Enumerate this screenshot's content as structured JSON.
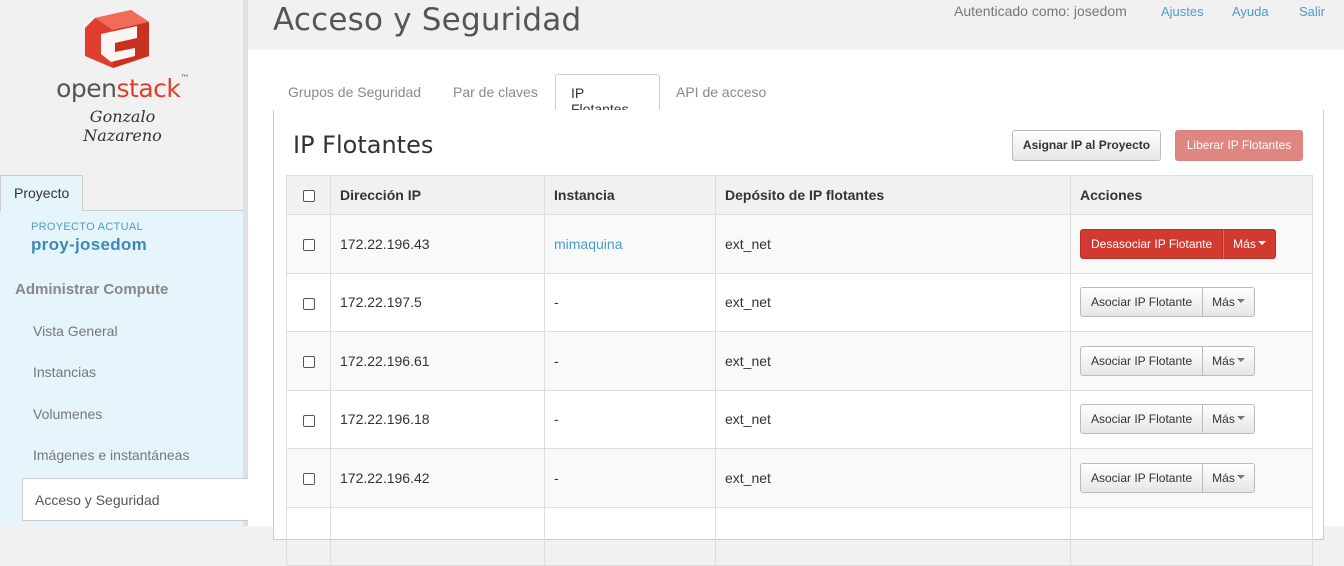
{
  "sidebar": {
    "logo": {
      "brand_open": "open",
      "brand_stack": "stack",
      "brand_tm": "™",
      "subtitle": "Gonzalo Nazareno"
    },
    "tab_label": "Proyecto",
    "current_project_label": "PROYECTO ACTUAL",
    "current_project_name": "proy-josedom",
    "section_heading": "Administrar Compute",
    "items": [
      {
        "label": "Vista General"
      },
      {
        "label": "Instancias"
      },
      {
        "label": "Volumenes"
      },
      {
        "label": "Imágenes e instantáneas"
      },
      {
        "label": "Acceso y Seguridad"
      }
    ]
  },
  "header": {
    "title": "Acceso y Seguridad",
    "authenticated_as": "Autenticado como: josedom",
    "links": [
      {
        "label": "Ajustes"
      },
      {
        "label": "Ayuda"
      },
      {
        "label": "Salir"
      }
    ]
  },
  "tabs": [
    {
      "label": "Grupos de Seguridad"
    },
    {
      "label": "Par de claves"
    },
    {
      "label": "IP Flotantes"
    },
    {
      "label": "API de acceso"
    }
  ],
  "panel": {
    "title": "IP Flotantes",
    "assign_button": "Asignar IP al Proyecto",
    "release_button": "Liberar IP Flotantes"
  },
  "table": {
    "columns": [
      "Dirección IP",
      "Instancia",
      "Depósito de IP flotantes",
      "Acciones"
    ],
    "rows": [
      {
        "ip": "172.22.196.43",
        "instance": "mimaquina",
        "pool": "ext_net",
        "action": "Desasociar IP Flotante",
        "more": "Más"
      },
      {
        "ip": "172.22.197.5",
        "instance": "-",
        "pool": "ext_net",
        "action": "Asociar IP Flotante",
        "more": "Más"
      },
      {
        "ip": "172.22.196.61",
        "instance": "-",
        "pool": "ext_net",
        "action": "Asociar IP Flotante",
        "more": "Más"
      },
      {
        "ip": "172.22.196.18",
        "instance": "-",
        "pool": "ext_net",
        "action": "Asociar IP Flotante",
        "more": "Más"
      },
      {
        "ip": "172.22.196.42",
        "instance": "-",
        "pool": "ext_net",
        "action": "Asociar IP Flotante",
        "more": "Más"
      },
      {
        "ip": "",
        "instance": "",
        "pool": "",
        "action": "",
        "more": ""
      }
    ]
  },
  "colors": {
    "link": "#4d9bc8",
    "danger": "#d23a30",
    "brand_red": "#e03e2d"
  }
}
